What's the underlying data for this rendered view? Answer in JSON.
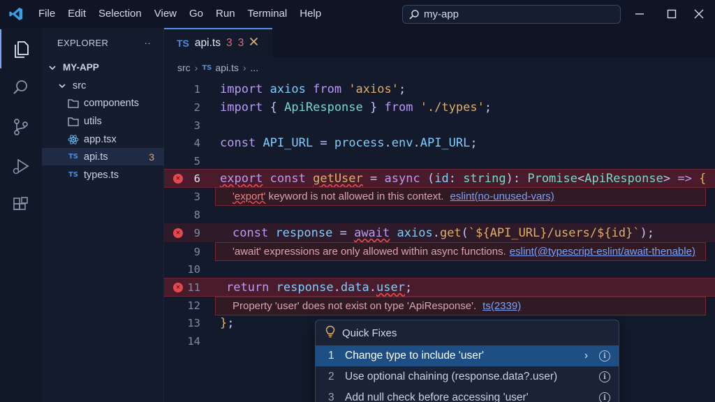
{
  "menu": [
    "File",
    "Edit",
    "Selection",
    "View",
    "Go",
    "Run",
    "Terminal",
    "Help"
  ],
  "search": {
    "text": "my-app"
  },
  "sidebar": {
    "title": "EXPLORER",
    "more": "··",
    "root": "MY-APP",
    "items": [
      {
        "label": "src",
        "icon": "chevron-down-icon"
      },
      {
        "label": "components",
        "icon": "folder-icon"
      },
      {
        "label": "utils",
        "icon": "folder-icon"
      },
      {
        "label": "app.tsx",
        "icon": "react-icon"
      },
      {
        "label": "api.ts",
        "icon": "ts-icon",
        "badge": "3"
      },
      {
        "label": "types.ts",
        "icon": "ts-icon"
      }
    ]
  },
  "tab": {
    "lang": "TS",
    "name": "api.ts",
    "count1": "3",
    "count2": "3"
  },
  "breadcrumb": {
    "part1": "src",
    "part2": "api.ts",
    "part3": "..."
  },
  "lines": {
    "n1": "1",
    "n2": "2",
    "n3": "3",
    "n4": "4",
    "n5": "5",
    "n6": "6",
    "n7": "3",
    "n8": "8",
    "n9": "9",
    "n10": "9",
    "n11": "10",
    "n12": "11",
    "n13": "12",
    "n14": "13",
    "n15": "14"
  },
  "diagnostics": {
    "d1_keyword": "'export'",
    "d1_text": " keyword is not allowed in this context.",
    "d1_link": "eslint(no-unused-vars)",
    "d2_text": "'await' expressions are only allowed within async functions.",
    "d2_link": "eslint(@typescript-eslint/await-thenable)",
    "d3_text": "Property 'user' does not exist on type 'ApiResponse'.",
    "d3_link": "ts(2339)"
  },
  "quick_fixes": {
    "title": "Quick Fixes",
    "items": [
      {
        "num": "1",
        "label": "Change type to include 'user'"
      },
      {
        "num": "2",
        "label": "Use optional chaining (response.data?.user)"
      },
      {
        "num": "3",
        "label": "Add null check before accessing 'user'"
      }
    ]
  },
  "colors": {
    "accent": "#5b8def",
    "error": "#e5484d",
    "selection": "#1d4f85"
  }
}
